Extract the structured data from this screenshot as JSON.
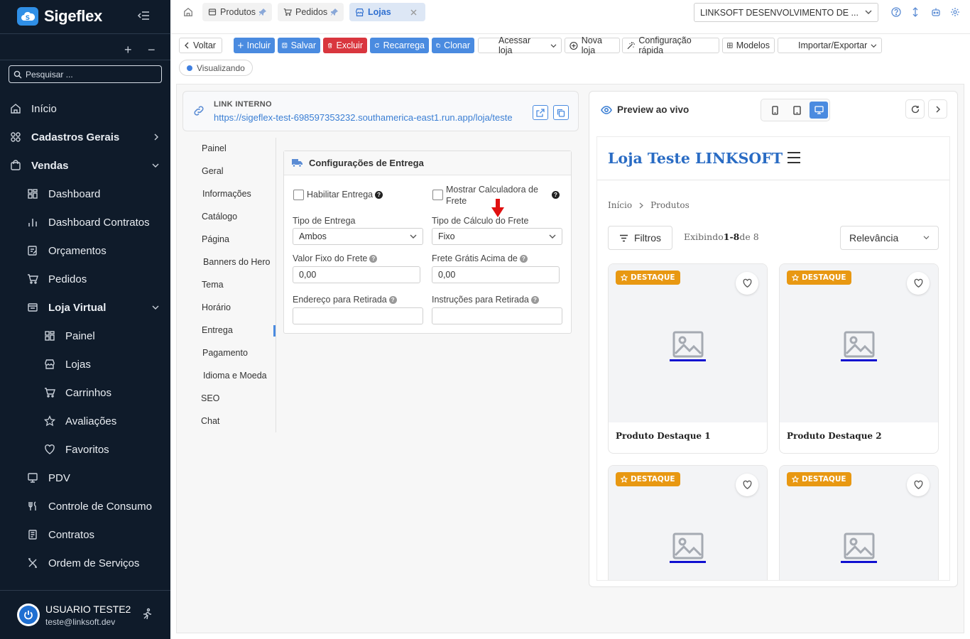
{
  "sidebar": {
    "app_name": "Sigeflex",
    "search_placeholder": "Pesquisar ...",
    "items": [
      {
        "label": "Início",
        "icon": "home-icon"
      },
      {
        "label": "Cadastros Gerais",
        "icon": "grid-icon"
      },
      {
        "label": "Vendas",
        "icon": "bag-icon"
      },
      {
        "label": "Dashboard",
        "icon": "dashboard-icon"
      },
      {
        "label": "Dashboard Contratos",
        "icon": "bar-chart-icon"
      },
      {
        "label": "Orçamentos",
        "icon": "edit-doc-icon"
      },
      {
        "label": "Pedidos",
        "icon": "cart-icon"
      },
      {
        "label": "Loja Virtual",
        "icon": "store-doc-icon"
      },
      {
        "label": "Painel",
        "icon": "dashboard-icon"
      },
      {
        "label": "Lojas",
        "icon": "store-icon"
      },
      {
        "label": "Carrinhos",
        "icon": "cart-icon"
      },
      {
        "label": "Avaliações",
        "icon": "star-icon"
      },
      {
        "label": "Favoritos",
        "icon": "heart-icon"
      },
      {
        "label": "PDV",
        "icon": "monitor-icon"
      },
      {
        "label": "Controle de Consumo",
        "icon": "utensils-icon"
      },
      {
        "label": "Contratos",
        "icon": "contract-icon"
      },
      {
        "label": "Ordem de Serviços",
        "icon": "tools-icon"
      }
    ],
    "user": {
      "name": "USUARIO TESTE2",
      "email": "teste@linksoft.dev"
    }
  },
  "topbar": {
    "tabs": [
      {
        "label": "Produtos"
      },
      {
        "label": "Pedidos"
      },
      {
        "label": "Lojas"
      }
    ],
    "company": "LINKSOFT DESENVOLVIMENTO DE ..."
  },
  "toolbar": {
    "voltar": "Voltar",
    "incluir": "Incluir",
    "salvar": "Salvar",
    "excluir": "Excluir",
    "recarrega": "Recarrega",
    "clonar": "Clonar",
    "acessar_loja": "Acessar loja",
    "nova_loja": "Nova loja",
    "config_rapida": "Configuração rápida",
    "modelos": "Modelos",
    "importar_exportar": "Importar/Exportar",
    "status": "Visualizando"
  },
  "link_card": {
    "title": "LINK INTERNO",
    "url": "https://sigeflex-test-698597353232.southamerica-east1.run.app/loja/teste"
  },
  "section_nav": [
    "Painel",
    "Geral",
    "Informações",
    "Catálogo",
    "Página",
    "Banners do Hero",
    "Tema",
    "Horário",
    "Entrega",
    "Pagamento",
    "Idioma e Moeda",
    "SEO",
    "Chat"
  ],
  "form": {
    "title": "Configurações de Entrega",
    "habilitar_entrega": "Habilitar Entrega",
    "mostrar_calc_1": "Mostrar Calculadora de",
    "mostrar_calc_2": "Frete",
    "tipo_entrega_label": "Tipo de Entrega",
    "tipo_entrega_value": "Ambos",
    "tipo_calculo_label": "Tipo de Cálculo do Frete",
    "tipo_calculo_value": "Fixo",
    "valor_fixo_label": "Valor Fixo do Frete",
    "valor_fixo_value": "0,00",
    "frete_gratis_label": "Frete Grátis Acima de",
    "frete_gratis_value": "0,00",
    "endereco_label": "Endereço para Retirada",
    "endereco_value": "",
    "instrucoes_label": "Instruções para Retirada",
    "instrucoes_value": ""
  },
  "preview": {
    "title": "Preview ao vivo",
    "store_name": "Loja Teste LINKSOFT",
    "breadcrumb": [
      "Início",
      "Produtos"
    ],
    "filtros": "Filtros",
    "exibindo_pre": "Exibindo",
    "exibindo_range": "1-8",
    "exibindo_post": "de 8",
    "sort": "Relevância",
    "badge": "DESTAQUE",
    "products": [
      "Produto Destaque 1",
      "Produto Destaque 2",
      "",
      ""
    ]
  },
  "colors": {
    "sidebar_bg": "#0f1b2a",
    "primary": "#4a8be0",
    "danger": "#d9363e",
    "badge": "#e89812",
    "store_title": "#2a6cc4"
  }
}
